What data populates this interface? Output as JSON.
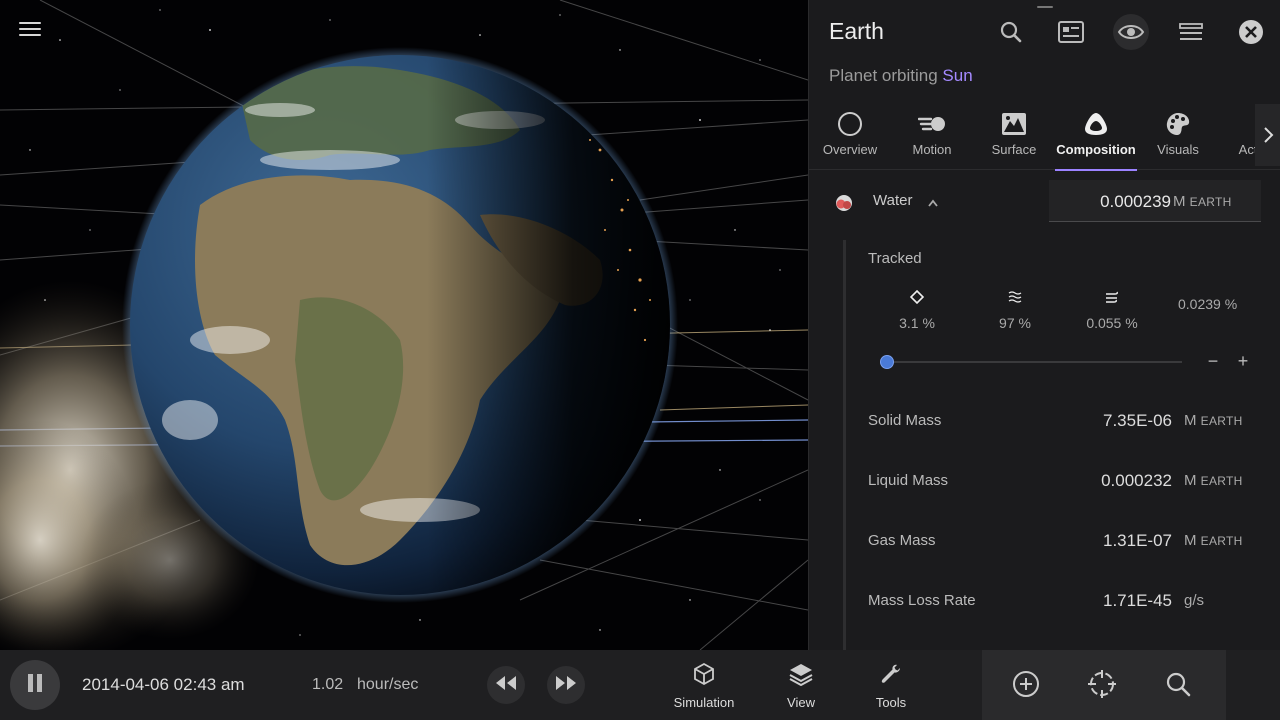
{
  "viewport": {
    "menu_icon": "hamburger-menu-icon"
  },
  "panel": {
    "title": "Earth",
    "subtitle_prefix": "Planet orbiting",
    "subtitle_link": "Sun",
    "header_icons": [
      "search-icon",
      "info-card-icon",
      "eye-icon",
      "list-icon",
      "close-icon"
    ],
    "accent": "#9b82ff",
    "link_color": "#a58aff",
    "tabs": [
      {
        "label": "Overview",
        "icon": "circle-icon"
      },
      {
        "label": "Motion",
        "icon": "motion-icon"
      },
      {
        "label": "Surface",
        "icon": "surface-map-icon"
      },
      {
        "label": "Composition",
        "icon": "composition-icon"
      },
      {
        "label": "Visuals",
        "icon": "palette-icon"
      },
      {
        "label": "Actions",
        "icon": "actions-icon"
      }
    ],
    "active_tab": "Composition",
    "composition": {
      "name": "Water",
      "value": "0.000239",
      "unit_main": "M",
      "unit_sub": "EARTH",
      "tracked_label": "Tracked",
      "phases": [
        {
          "icon": "solid-phase-icon",
          "value": "3.1 %"
        },
        {
          "icon": "liquid-phase-icon",
          "value": "97 %"
        },
        {
          "icon": "gas-phase-icon",
          "value": "0.055 %"
        }
      ],
      "total_percent": "0.0239 %",
      "slider_fraction": 0.0,
      "stepper_minus": "−",
      "stepper_plus": "+",
      "properties": [
        {
          "label": "Solid Mass",
          "value": "7.35E-06",
          "unit_main": "M",
          "unit_sub": "EARTH"
        },
        {
          "label": "Liquid Mass",
          "value": "0.000232",
          "unit_main": "M",
          "unit_sub": "EARTH"
        },
        {
          "label": "Gas Mass",
          "value": "1.31E-07",
          "unit_main": "M",
          "unit_sub": "EARTH"
        },
        {
          "label": "Mass Loss Rate",
          "value": "1.71E-45",
          "unit_main": "g/s",
          "unit_sub": ""
        }
      ]
    }
  },
  "bottombar": {
    "datetime": "2014-04-06 02:43 am",
    "rate_value": "1.02",
    "rate_unit": "hour/sec",
    "tools": [
      {
        "label": "Simulation",
        "icon": "cube-icon"
      },
      {
        "label": "View",
        "icon": "layers-icon"
      },
      {
        "label": "Tools",
        "icon": "wrench-icon"
      }
    ],
    "right_icons": [
      "add-circle-icon",
      "target-recenter-icon",
      "zoom-search-icon"
    ]
  }
}
